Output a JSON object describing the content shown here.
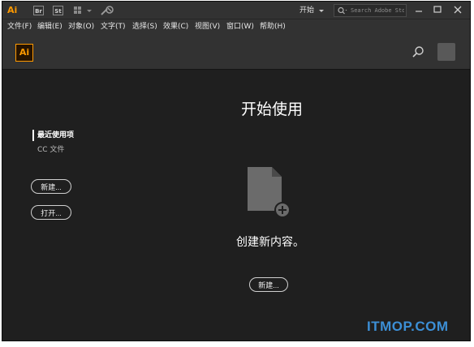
{
  "titlebar": {
    "app_logo": "Ai",
    "bridge_label": "Br",
    "stock_label": "St",
    "icons": [
      "arrange-documents-icon",
      "gpu-performance-icon"
    ],
    "workspace_label": "开始",
    "search_placeholder": "Search Adobe Stock",
    "window_controls": [
      "minimize-icon",
      "maximize-icon",
      "close-icon"
    ]
  },
  "menubar": {
    "items": [
      {
        "label": "文件(F)"
      },
      {
        "label": "编辑(E)"
      },
      {
        "label": "对象(O)"
      },
      {
        "label": "文字(T)"
      },
      {
        "label": "选择(S)"
      },
      {
        "label": "效果(C)"
      },
      {
        "label": "视图(V)"
      },
      {
        "label": "窗口(W)"
      },
      {
        "label": "帮助(H)"
      }
    ]
  },
  "header": {
    "logo": "Ai",
    "search_icon": "search-icon",
    "avatar_icon": "avatar"
  },
  "sidebar": {
    "recent_label": "最近使用项",
    "cc_files_label": "CC 文件",
    "new_button": "新建...",
    "open_button": "打开..."
  },
  "main": {
    "title": "开始使用",
    "icon": "new-document-icon",
    "create_text": "创建新内容。",
    "new_button": "新建..."
  },
  "watermark": "ITMOP.COM",
  "colors": {
    "background": "#1f1f1f",
    "bar": "#323232",
    "ai_orange": "#ff9a00",
    "watermark_blue": "#3c8fd6"
  }
}
